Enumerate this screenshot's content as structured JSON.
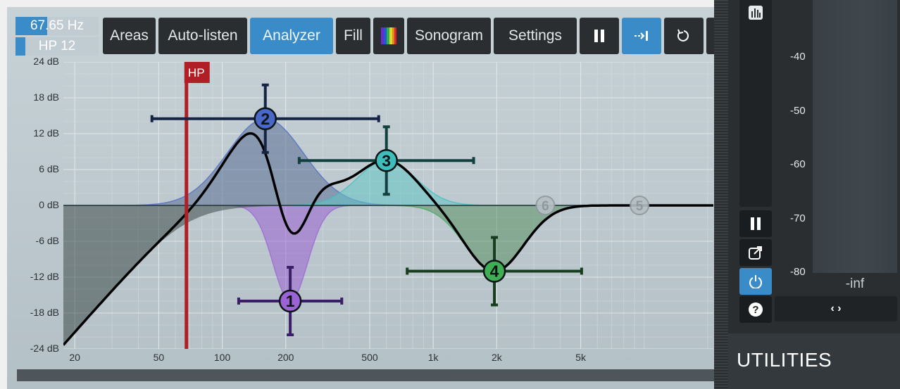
{
  "readouts": {
    "frequency": "67.65 Hz",
    "band": "HP 12",
    "frequency_level": 0.38,
    "band_level": 0.12
  },
  "toolbar": {
    "areas": "Areas",
    "auto_listen": "Auto-listen",
    "analyzer": "Analyzer",
    "fill": "Fill",
    "sonogram": "Sonogram",
    "settings": "Settings"
  },
  "toolbar_icons": [
    "spectrum-icon",
    "pause-icon",
    "follow-icon",
    "undo-icon"
  ],
  "active_buttons": [
    "analyzer",
    "follow"
  ],
  "graph": {
    "y_labels": [
      "24 dB",
      "18 dB",
      "12 dB",
      "6 dB",
      "0 dB",
      "-6 dB",
      "-12 dB",
      "-18 dB",
      "-24 dB"
    ],
    "y_values": [
      24,
      18,
      12,
      6,
      0,
      -6,
      -12,
      -18,
      -24
    ],
    "x_labels": [
      "20",
      "50",
      "100",
      "200",
      "500",
      "1k",
      "2k",
      "5k"
    ],
    "x_values": [
      20,
      50,
      100,
      200,
      500,
      1000,
      2000,
      5000
    ],
    "x_range_hz": [
      17.66,
      21280
    ],
    "y_range_db": [
      -24,
      24
    ],
    "hp_label": "HP",
    "hp_freq": 67.65,
    "bands": [
      {
        "label": "1",
        "freq": 210,
        "gain": -16,
        "q": 2.2,
        "color": "#9a63d6",
        "fill": "#9b61d2",
        "enabled": true
      },
      {
        "label": "2",
        "freq": 160,
        "gain": 14.5,
        "q": 1.0,
        "color": "#4a68c8",
        "fill": "#5a6d94",
        "enabled": true
      },
      {
        "label": "3",
        "freq": 600,
        "gain": 7.5,
        "q": 1.3,
        "color": "#3fbdbd",
        "fill": "#62c4c6",
        "enabled": true
      },
      {
        "label": "4",
        "freq": 1950,
        "gain": -11,
        "q": 1.3,
        "color": "#3fae55",
        "fill": "#5a8f63",
        "enabled": true
      },
      {
        "label": "5",
        "freq": 9500,
        "gain": 0,
        "q": 1,
        "color": "#9aa5aa",
        "enabled": false
      },
      {
        "label": "6",
        "freq": 3400,
        "gain": 0,
        "q": 1,
        "color": "#9aa5aa",
        "enabled": false
      }
    ]
  },
  "meter": {
    "labels": [
      "-40",
      "-50",
      "-60",
      "-70",
      "-80"
    ],
    "readout": "-inf"
  },
  "side_icons": [
    "meter-icon",
    "pause-icon",
    "popout-icon",
    "power-icon",
    "help-icon"
  ],
  "lr_button": "‹ ›",
  "utilities": {
    "title": "UTILITIES"
  },
  "colors": {
    "panel": "#2a2e31",
    "accent": "#3a8cc9",
    "hp": "#b01f26",
    "curve": "#000000"
  }
}
